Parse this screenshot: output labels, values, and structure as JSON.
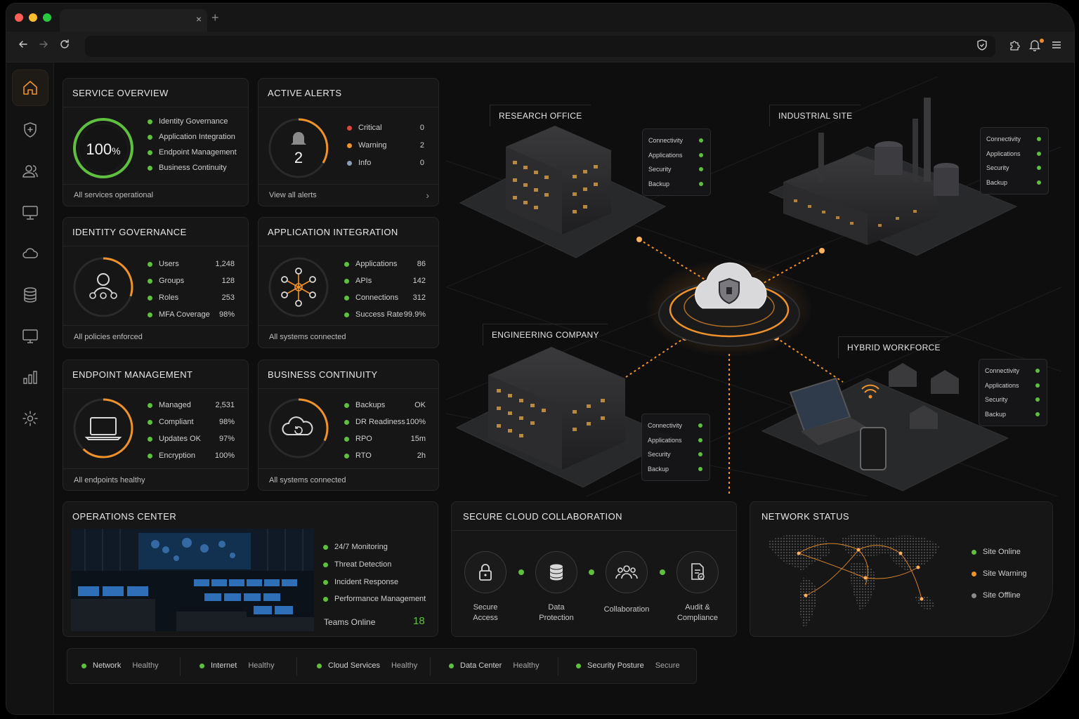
{
  "colors": {
    "green": "#5fbf3f",
    "orange": "#f0922b",
    "red": "#d9483b",
    "grey": "#8a8a8a",
    "blue_grey": "#8d9db3"
  },
  "browser": {
    "close_glyph": "×",
    "new_tab_glyph": "+"
  },
  "sidebar": [
    "home-icon",
    "shield-icon",
    "users-icon",
    "monitor-icon",
    "cloud-icon",
    "database-icon",
    "desktop-icon",
    "bar-chart-icon",
    "gear-icon"
  ],
  "service_overview": {
    "title": "SERVICE OVERVIEW",
    "percent": "100",
    "percent_unit": "%",
    "progress": 1.0,
    "items": [
      "Identity Governance",
      "Application Integration",
      "Endpoint Management",
      "Business Continuity"
    ],
    "footer": "All services operational"
  },
  "active_alerts": {
    "title": "ACTIVE ALERTS",
    "count": "2",
    "rows": [
      {
        "label": "Critical",
        "value": "0"
      },
      {
        "label": "Warning",
        "value": "2"
      },
      {
        "label": "Info",
        "value": "0"
      }
    ],
    "footer": "View all alerts",
    "chevron": "›"
  },
  "identity_governance": {
    "title": "IDENTITY GOVERNANCE",
    "progress": 0.3,
    "rows": [
      {
        "label": "Users",
        "value": "1,248"
      },
      {
        "label": "Groups",
        "value": "128"
      },
      {
        "label": "Roles",
        "value": "253"
      },
      {
        "label": "MFA Coverage",
        "value": "98%"
      }
    ],
    "footer": "All policies enforced"
  },
  "application_integration": {
    "title": "APPLICATION INTEGRATION",
    "rows": [
      {
        "label": "Applications",
        "value": "86"
      },
      {
        "label": "APIs",
        "value": "142"
      },
      {
        "label": "Connections",
        "value": "312"
      },
      {
        "label": "Success Rate",
        "value": "99.9%"
      }
    ],
    "footer": "All systems connected"
  },
  "endpoint_management": {
    "title": "ENDPOINT MANAGEMENT",
    "progress": 0.62,
    "rows": [
      {
        "label": "Managed",
        "value": "2,531"
      },
      {
        "label": "Compliant",
        "value": "98%"
      },
      {
        "label": "Updates OK",
        "value": "97%"
      },
      {
        "label": "Encryption",
        "value": "100%"
      }
    ],
    "footer": "All endpoints healthy"
  },
  "business_continuity": {
    "title": "BUSINESS CONTINUITY",
    "progress": 0.32,
    "rows": [
      {
        "label": "Backups",
        "value": "OK"
      },
      {
        "label": "DR Readiness",
        "value": "100%"
      },
      {
        "label": "RPO",
        "value": "15m"
      },
      {
        "label": "RTO",
        "value": "2h"
      }
    ],
    "footer": "All systems connected"
  },
  "sites": {
    "card_rows": [
      "Connectivity",
      "Applications",
      "Security",
      "Backup"
    ],
    "research_office": "RESEARCH OFFICE",
    "industrial_site": "INDUSTRIAL SITE",
    "engineering_company": "ENGINEERING COMPANY",
    "hybrid_workforce": "HYBRID WORKFORCE"
  },
  "operations_center": {
    "title": "OPERATIONS CENTER",
    "items": [
      "24/7 Monitoring",
      "Threat Detection",
      "Incident Response",
      "Performance Management"
    ],
    "teams_label": "Teams Online",
    "teams_value": "18"
  },
  "secure_cloud_collaboration": {
    "title": "SECURE CLOUD COLLABORATION",
    "nodes": [
      {
        "icon": "lock-icon",
        "line1": "Secure",
        "line2": "Access"
      },
      {
        "icon": "database-icon",
        "line1": "Data",
        "line2": "Protection"
      },
      {
        "icon": "people-icon",
        "line1": "Collaboration",
        "line2": ""
      },
      {
        "icon": "audit-document-icon",
        "line1": "Audit &",
        "line2": "Compliance"
      }
    ]
  },
  "network_status": {
    "title": "NETWORK STATUS",
    "legend": [
      {
        "label": "Site Online",
        "color": "#5fbf3f"
      },
      {
        "label": "Site Warning",
        "color": "#f0922b"
      },
      {
        "label": "Site Offline",
        "color": "#8a8a8a"
      }
    ]
  },
  "status_bar": [
    {
      "label": "Network",
      "state": "Healthy"
    },
    {
      "label": "Internet",
      "state": "Healthy"
    },
    {
      "label": "Cloud Services",
      "state": "Healthy"
    },
    {
      "label": "Data Center",
      "state": "Healthy"
    },
    {
      "label": "Security Posture",
      "state": "Secure"
    }
  ]
}
